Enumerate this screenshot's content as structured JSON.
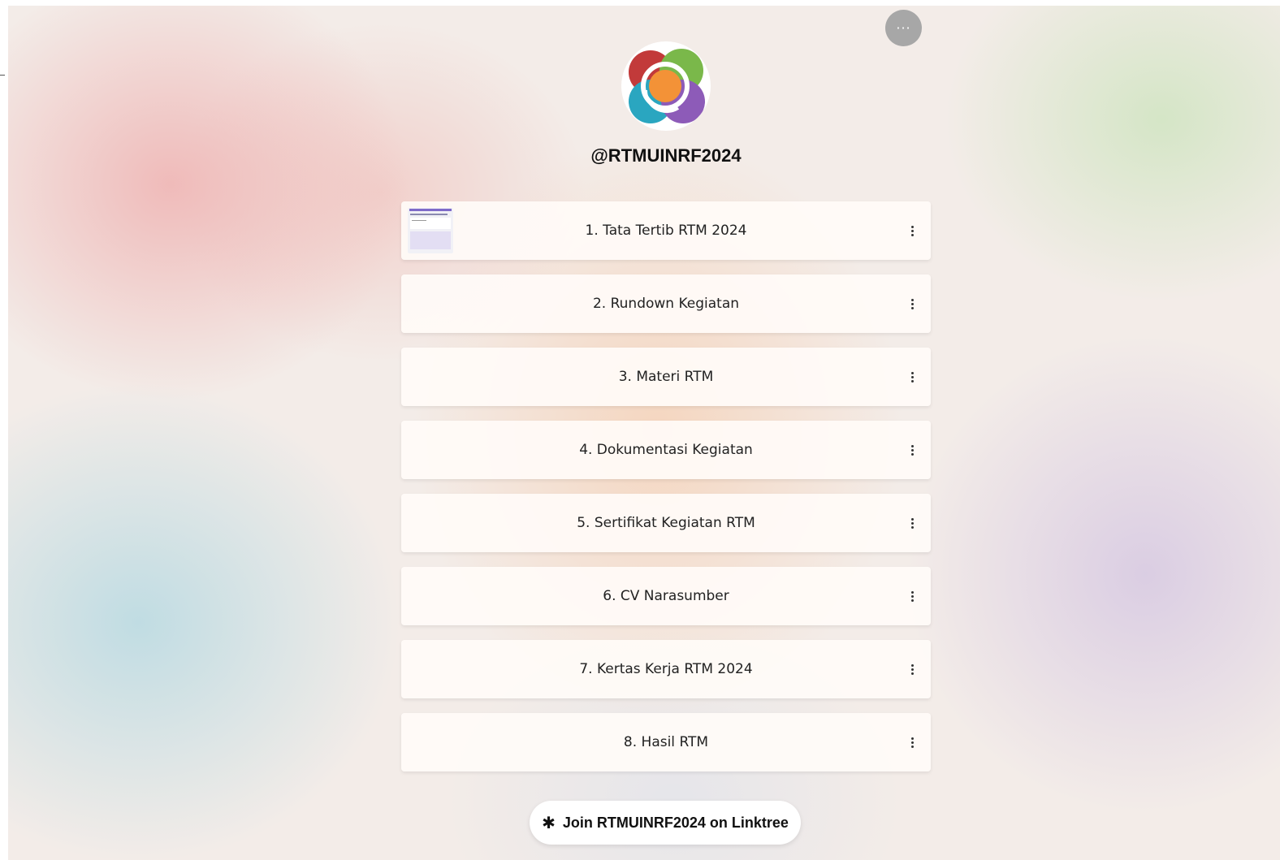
{
  "profile": {
    "handle": "@RTMUINRF2024",
    "avatar_icon": "flower-logo-icon"
  },
  "header": {
    "more_label": "···"
  },
  "links": [
    {
      "label": "1. Tata Tertib RTM 2024",
      "has_thumbnail": true
    },
    {
      "label": "2. Rundown Kegiatan",
      "has_thumbnail": false
    },
    {
      "label": "3. Materi RTM",
      "has_thumbnail": false
    },
    {
      "label": "4. Dokumentasi Kegiatan",
      "has_thumbnail": false
    },
    {
      "label": "5. Sertifikat Kegiatan RTM",
      "has_thumbnail": false
    },
    {
      "label": "6. CV Narasumber",
      "has_thumbnail": false
    },
    {
      "label": "7. Kertas Kerja RTM 2024",
      "has_thumbnail": false
    },
    {
      "label": "8. Hasil RTM",
      "has_thumbnail": false
    }
  ],
  "footer": {
    "join_label": "Join RTMUINRF2024 on Linktree",
    "join_icon": "linktree-asterisk-icon"
  },
  "colors": {
    "logo_red": "#c23a3a",
    "logo_green": "#7ab84a",
    "logo_teal": "#2aa6c0",
    "logo_purple": "#8d5bb8",
    "logo_orange": "#f39237"
  }
}
